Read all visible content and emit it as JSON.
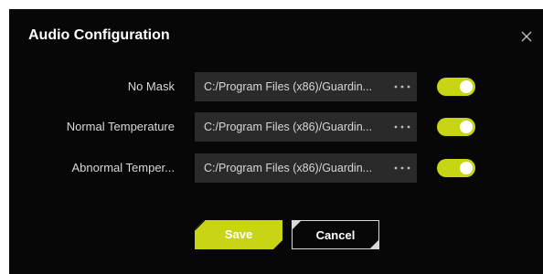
{
  "dialog": {
    "title": "Audio Configuration",
    "close_icon": "close-icon"
  },
  "rows": [
    {
      "label": "No Mask",
      "path": "C:/Program Files (x86)/Guardin...",
      "more": "···",
      "enabled": true
    },
    {
      "label": "Normal Temperature",
      "path": "C:/Program Files (x86)/Guardin...",
      "more": "···",
      "enabled": true
    },
    {
      "label": "Abnormal Temper...",
      "path": "C:/Program Files (x86)/Guardin...",
      "more": "···",
      "enabled": true
    }
  ],
  "buttons": {
    "save": "Save",
    "cancel": "Cancel"
  },
  "colors": {
    "background": "#070707",
    "accent": "#c8d514",
    "field": "#2a2a2a"
  }
}
